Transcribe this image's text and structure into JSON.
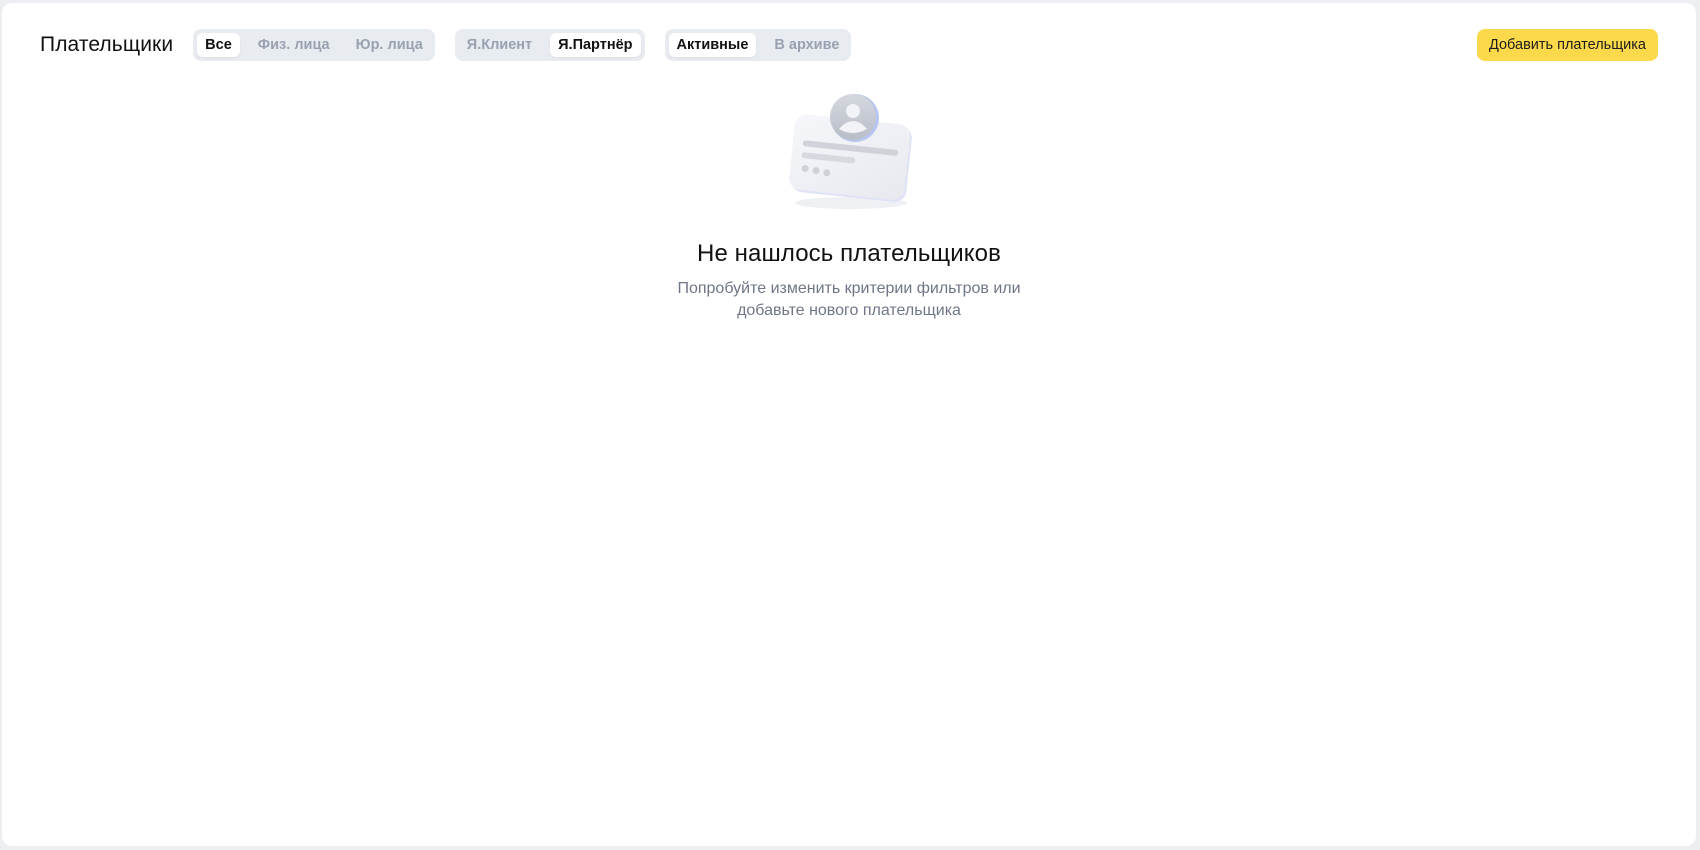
{
  "header": {
    "title": "Плательщики",
    "type_filter": {
      "options": [
        "Все",
        "Физ. лица",
        "Юр. лица"
      ],
      "selected": "Все"
    },
    "service_filter": {
      "options": [
        "Я.Клиент",
        "Я.Партнёр"
      ],
      "selected": "Я.Партнёр"
    },
    "status_filter": {
      "options": [
        "Активные",
        "В архиве"
      ],
      "selected": "Активные"
    },
    "add_button_label": "Добавить плательщика"
  },
  "empty_state": {
    "illustration_icon": "payer-card-icon",
    "title": "Не нашлось плательщиков",
    "subtitle_line1": "Попробуйте изменить критерии фильтров или",
    "subtitle_line2": "добавьте нового плательщика"
  },
  "colors": {
    "accent_button": "#fcd94a",
    "segment_background": "#e8ebf0",
    "inactive_text": "#99a1b1",
    "page_background": "#eceef2"
  }
}
